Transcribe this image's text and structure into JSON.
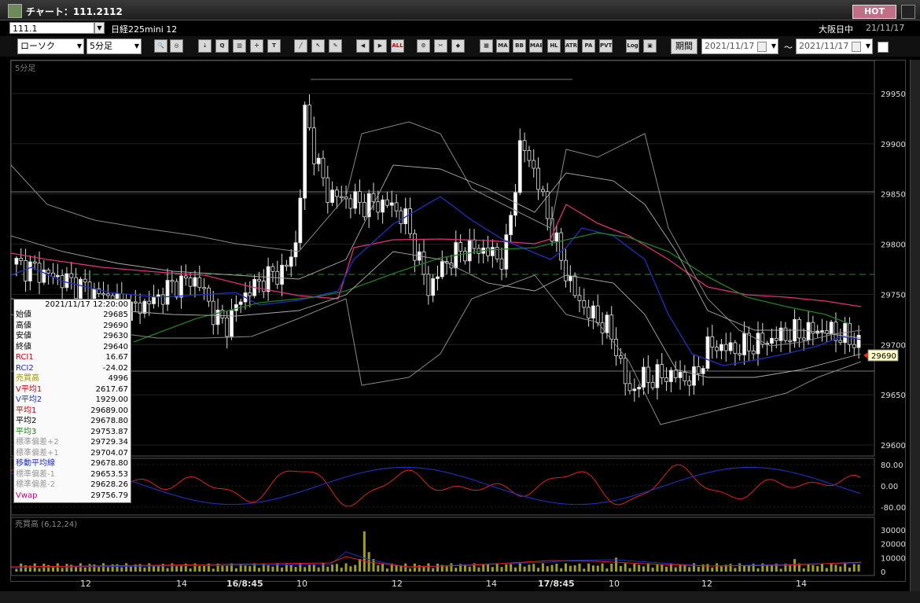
{
  "window": {
    "title": "チャート：111.2112",
    "hot_label": "HOT"
  },
  "symbol_bar": {
    "symbol_code": "111.1",
    "instrument": "日経225mini 12",
    "session": "大阪日中",
    "session_date": "21/11/17"
  },
  "toolbar": {
    "chart_type": "ローソク",
    "timeframe": "5分足",
    "buttons": [
      "MA",
      "BB",
      "MAE",
      "HL",
      "ATR",
      "PA RA",
      "PVT",
      "Log"
    ],
    "period_label": "期間",
    "from_date": "2021/11/17",
    "tilde": "〜",
    "to_date": "2021/11/17"
  },
  "chart": {
    "timeframe_label": "5分足",
    "price_ticks": [
      "29950",
      "29900",
      "29850",
      "29800",
      "29750",
      "29700",
      "29650",
      "29600"
    ],
    "last_price": "29690",
    "osc_ticks": [
      "80.00",
      "0.00",
      "-80.00"
    ],
    "volume_label": "売買高 (6,12,24)",
    "volume_ticks": [
      "30000",
      "20000",
      "10000",
      "0"
    ],
    "time_labels": [
      "12",
      "14",
      "16/8:45",
      "10",
      "12",
      "14",
      "17/8:45",
      "10",
      "12",
      "14"
    ],
    "colors": {
      "candle_up": "#ffffff",
      "candle_down": "#000000",
      "ma1": "#e0307a",
      "ma2": "#2030c0",
      "ma3": "#208020",
      "rci1": "#e02020",
      "rci2": "#2030c0",
      "bb": "#888888",
      "volume": "#a0a020",
      "vwap_line": "#2a8a2a"
    }
  },
  "info_panel": {
    "datetime": "2021/11/17  12:20:00",
    "rows": [
      {
        "k": "始値",
        "v": "29685",
        "c": "#000"
      },
      {
        "k": "高値",
        "v": "29690",
        "c": "#000"
      },
      {
        "k": "安値",
        "v": "29630",
        "c": "#000"
      },
      {
        "k": "終値",
        "v": "29640",
        "c": "#000"
      },
      {
        "k": "RCI1",
        "v": "16.67",
        "c": "#d00000"
      },
      {
        "k": "RCI2",
        "v": "-24.02",
        "c": "#2030c0"
      },
      {
        "k": "売買高",
        "v": "4996",
        "c": "#a09000"
      },
      {
        "k": "V平均1",
        "v": "2617.67",
        "c": "#d00000"
      },
      {
        "k": "V平均2",
        "v": "1929.00",
        "c": "#2030c0"
      },
      {
        "k": "平均1",
        "v": "29689.00",
        "c": "#d00000"
      },
      {
        "k": "平均2",
        "v": "29678.80",
        "c": "#000"
      },
      {
        "k": "平均3",
        "v": "29753.87",
        "c": "#208020"
      },
      {
        "k": "標準偏差+2",
        "v": "29729.34",
        "c": "#999"
      },
      {
        "k": "標準偏差+1",
        "v": "29704.07",
        "c": "#999"
      },
      {
        "k": "移動平均線",
        "v": "29678.80",
        "c": "#2030c0"
      },
      {
        "k": "標準偏差-1",
        "v": "29653.53",
        "c": "#999"
      },
      {
        "k": "標準偏差-2",
        "v": "29628.26",
        "c": "#999"
      },
      {
        "k": "Vwap",
        "v": "29756.79",
        "c": "#d00080"
      }
    ]
  }
}
